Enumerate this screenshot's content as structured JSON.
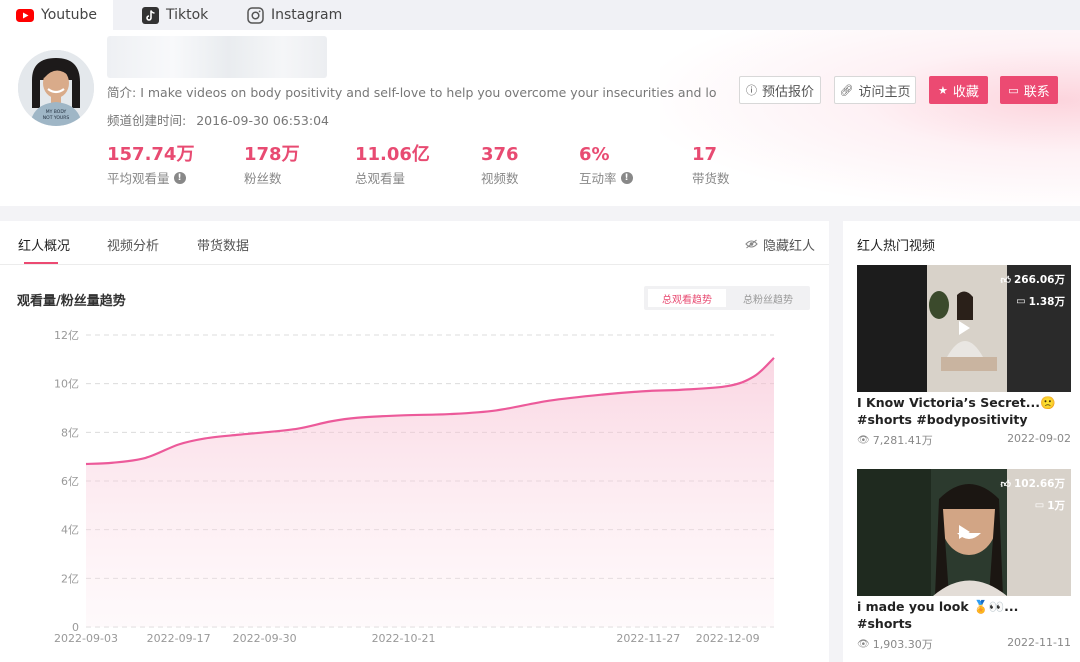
{
  "platform_tabs": [
    {
      "label": "Youtube",
      "icon": "youtube-icon",
      "active": true
    },
    {
      "label": "Tiktok",
      "icon": "tiktok-icon",
      "active": false
    },
    {
      "label": "Instagram",
      "icon": "instagram-icon",
      "active": false
    }
  ],
  "profile": {
    "intro_label": "简介:",
    "intro_text": "I make videos on body positivity and self-love to help you overcome your insecurities and love y...",
    "created_label": "频道创建时间:",
    "created_value": "2016-09-30 06:53:04",
    "avatar_shirt_text": "MY BODY NOT YOURS",
    "buttons": {
      "quote": "预估报价",
      "visit": "访问主页",
      "collect": "收藏",
      "contact": "联系"
    },
    "stats": [
      {
        "value": "157.74万",
        "label": "平均观看量",
        "info": true
      },
      {
        "value": "178万",
        "label": "粉丝数",
        "info": false
      },
      {
        "value": "11.06亿",
        "label": "总观看量",
        "info": false
      },
      {
        "value": "376",
        "label": "视频数",
        "info": false
      },
      {
        "value": "6%",
        "label": "互动率",
        "info": true
      },
      {
        "value": "17",
        "label": "带货数",
        "info": false
      }
    ]
  },
  "main": {
    "tabs": [
      "红人概况",
      "视频分析",
      "带货数据"
    ],
    "hide_label": "隐藏红人",
    "chart_title": "观看量/粉丝量趋势",
    "toggle_on": "总观看趋势",
    "toggle_off": "总粉丝趋势"
  },
  "chart_data": {
    "type": "area",
    "title": "",
    "xlabel": "",
    "ylabel": "",
    "x": [
      "2022-09-03",
      "2022-09-07",
      "2022-09-12",
      "2022-09-17",
      "2022-09-21",
      "2022-09-26",
      "2022-09-30",
      "2022-10-05",
      "2022-10-10",
      "2022-10-14",
      "2022-10-21",
      "2022-10-28",
      "2022-11-04",
      "2022-11-12",
      "2022-11-20",
      "2022-11-27",
      "2022-12-02",
      "2022-12-09",
      "2022-12-13",
      "2022-12-16"
    ],
    "series": [
      {
        "values": [
          6.7,
          6.75,
          6.95,
          7.5,
          7.75,
          7.9,
          8.0,
          8.15,
          8.45,
          8.6,
          8.7,
          8.75,
          8.9,
          9.3,
          9.55,
          9.7,
          9.75,
          9.9,
          10.3,
          11.06
        ]
      }
    ],
    "x_ticks": [
      "2022-09-03",
      "2022-09-17",
      "2022-09-30",
      "2022-10-21",
      "2022-11-27",
      "2022-12-09"
    ],
    "y_ticks": [
      "0",
      "2亿",
      "4亿",
      "6亿",
      "8亿",
      "10亿",
      "12亿"
    ],
    "ylim": [
      0,
      12
    ],
    "grid": true,
    "color": "#ec5a9a"
  },
  "side": {
    "title": "红人热门视频",
    "videos": [
      {
        "likes": "266.06万",
        "comments": "1.38万",
        "title": "I Know Victoria’s Secret...🙁 #shorts #bodypositivity",
        "views": "7,281.41万",
        "date": "2022-09-02"
      },
      {
        "likes": "102.66万",
        "comments": "1万",
        "title": "i made you look 🏅👀... #shorts",
        "views": "1,903.30万",
        "date": "2022-11-11"
      }
    ]
  },
  "colors": {
    "accent": "#ec4a72",
    "chart_line": "#ec5a9a"
  }
}
